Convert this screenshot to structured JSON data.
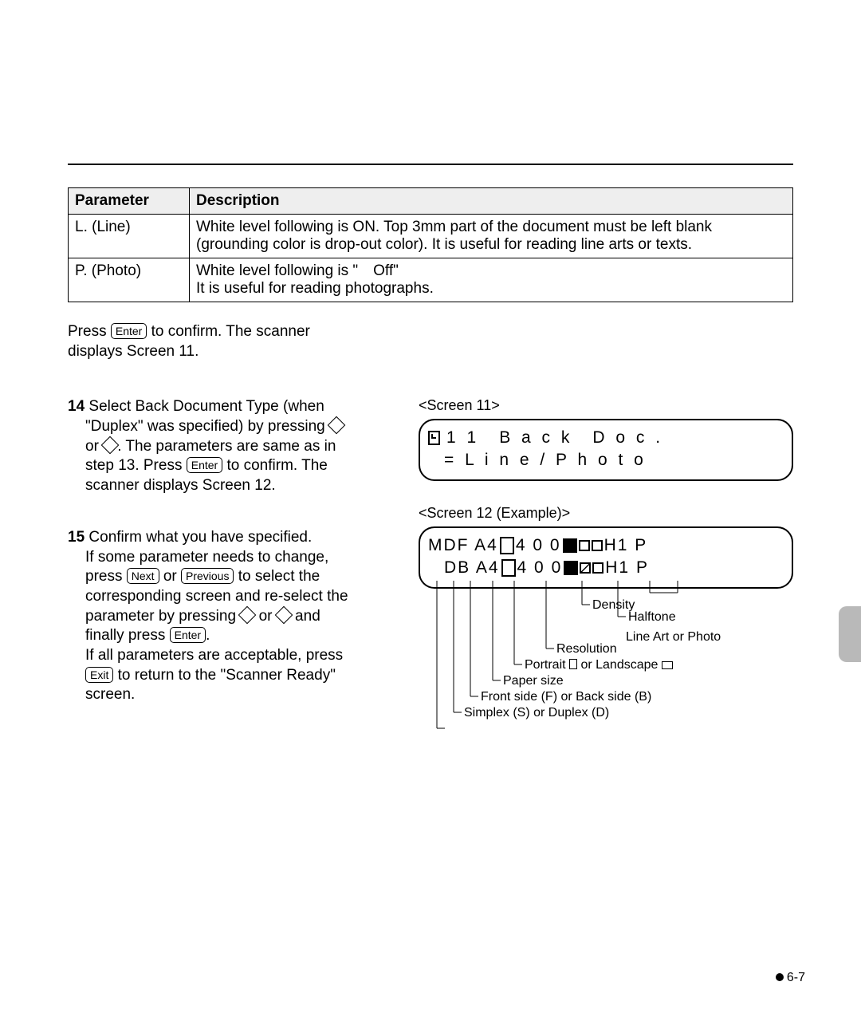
{
  "table": {
    "headers": {
      "param": "Parameter",
      "desc": "Description"
    },
    "rows": [
      {
        "param": "L. (Line)",
        "desc": "White level following is ON. Top 3mm part of the document must be left blank (grounding color is drop-out color). It is useful for reading line arts or texts."
      },
      {
        "param": "P. (Photo)",
        "desc_line1": "White level following is \" Off\"",
        "desc_line2": "It is useful for reading photographs."
      }
    ]
  },
  "intro": {
    "pre": "Press ",
    "key": "Enter",
    "post1": " to confirm. The scanner",
    "post2": "displays Screen 11."
  },
  "steps": {
    "s14": {
      "num": "14",
      "l1": " Select Back Document Type (when",
      "l2a": "\"Duplex\" was specified) by pressing ",
      "l3a": "or ",
      "l3b": ". The parameters are same as in",
      "l4a": "step 13. Press ",
      "l4key": "Enter",
      "l4b": " to confirm. The",
      "l5": "scanner displays Screen 12."
    },
    "s15": {
      "num": "15",
      "l1": " Confirm what you have specified.",
      "l2": "If some parameter needs to change,",
      "l3a": "press ",
      "k_next": "Next",
      "l3b": " or ",
      "k_prev": "Previous",
      "l3c": " to select the",
      "l4": "corresponding screen and re-select the",
      "l5a": "parameter by pressing  ",
      "l5b": " or ",
      "l5c": " and",
      "l6a": "finally press ",
      "k_enter": "Enter",
      "l6b": ".",
      "l7": "If all parameters are acceptable, press",
      "k_exit": "Exit",
      "l8": " to return to the \"Scanner Ready\"",
      "l9": "screen."
    }
  },
  "screens": {
    "s11": {
      "label": "<Screen 11>",
      "row1": "1 1 B a c k D o c .",
      "row2": "= L i n e / P h o t o"
    },
    "s12": {
      "label": "<Screen 12 (Example)>",
      "row1_a": "MDF A4",
      "row1_b": "4 0 0",
      "row1_c": "H1 P",
      "row2_a": "DB A4",
      "row2_b": "4 0 0",
      "row2_c": "H1 P"
    }
  },
  "callouts": {
    "density": "Density",
    "halftone": "Halftone",
    "lineart": "Line Art or Photo",
    "resolution": "Resolution",
    "orient_a": "Portrait ",
    "orient_b": " or Landscape ",
    "paper": "Paper size",
    "side": "Front side (F) or Back side (B)",
    "plex": "Simplex (S) or Duplex (D)"
  },
  "page_number": "6-7"
}
